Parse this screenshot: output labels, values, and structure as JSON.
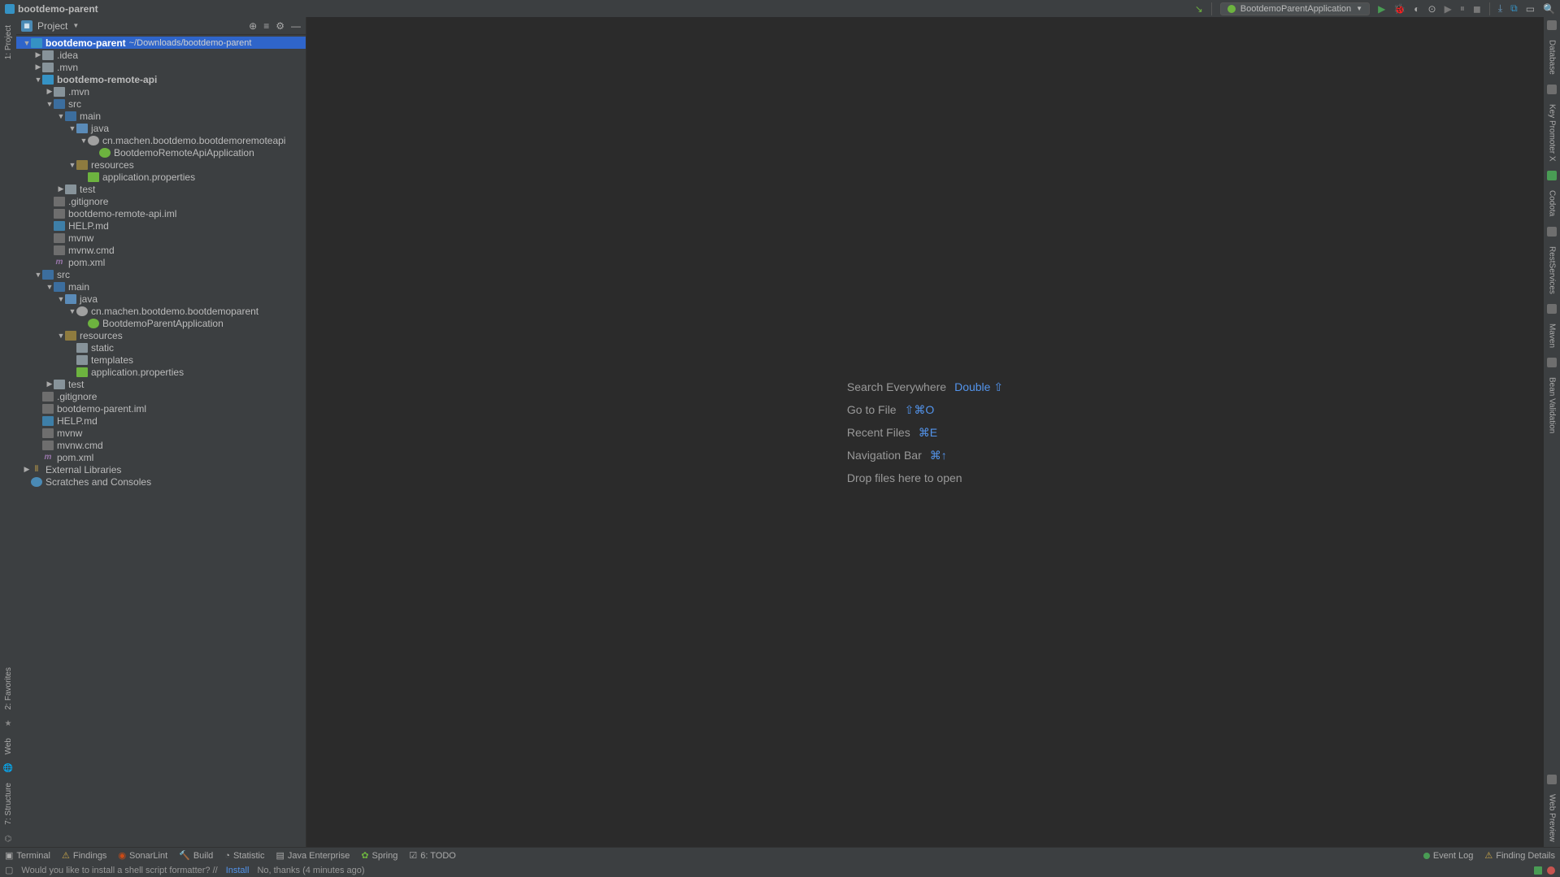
{
  "topbar": {
    "project_name": "bootdemo-parent",
    "run_config": "BootdemoParentApplication"
  },
  "panel": {
    "title": "Project"
  },
  "tree": [
    {
      "d": 0,
      "a": "down",
      "i": "module-icon",
      "t": "bootdemo-parent",
      "path": "~/Downloads/bootdemo-parent",
      "sel": true,
      "name": "project-root",
      "bold": true
    },
    {
      "d": 1,
      "a": "right",
      "i": "folder-icon",
      "t": ".idea",
      "name": "folder-idea"
    },
    {
      "d": 1,
      "a": "right",
      "i": "folder-icon",
      "t": ".mvn",
      "name": "folder-mvn"
    },
    {
      "d": 1,
      "a": "down",
      "i": "module-icon",
      "t": "bootdemo-remote-api",
      "name": "module-remote-api",
      "bold": true
    },
    {
      "d": 2,
      "a": "right",
      "i": "folder-icon",
      "t": ".mvn",
      "name": "folder-mvn-2"
    },
    {
      "d": 2,
      "a": "down",
      "i": "src-folder",
      "t": "src",
      "name": "folder-src"
    },
    {
      "d": 3,
      "a": "down",
      "i": "src-folder",
      "t": "main",
      "name": "folder-main"
    },
    {
      "d": 4,
      "a": "down",
      "i": "java-folder",
      "t": "java",
      "name": "folder-java"
    },
    {
      "d": 5,
      "a": "down",
      "i": "pkg-icon",
      "t": "cn.machen.bootdemo.bootdemoremoteapi",
      "name": "package"
    },
    {
      "d": 6,
      "a": "none",
      "i": "class-icon",
      "t": "BootdemoRemoteApiApplication",
      "name": "class-remote-app"
    },
    {
      "d": 4,
      "a": "down",
      "i": "res-folder",
      "t": "resources",
      "name": "folder-resources"
    },
    {
      "d": 5,
      "a": "none",
      "i": "prop-icon",
      "t": "application.properties",
      "name": "file-app-props"
    },
    {
      "d": 3,
      "a": "right",
      "i": "folder-icon",
      "t": "test",
      "name": "folder-test"
    },
    {
      "d": 2,
      "a": "none",
      "i": "file-icon",
      "t": ".gitignore",
      "name": "file-gitignore"
    },
    {
      "d": 2,
      "a": "none",
      "i": "file-icon",
      "t": "bootdemo-remote-api.iml",
      "name": "file-iml"
    },
    {
      "d": 2,
      "a": "none",
      "i": "md-icon",
      "t": "HELP.md",
      "name": "file-help-md"
    },
    {
      "d": 2,
      "a": "none",
      "i": "file-icon",
      "t": "mvnw",
      "name": "file-mvnw"
    },
    {
      "d": 2,
      "a": "none",
      "i": "file-icon",
      "t": "mvnw.cmd",
      "name": "file-mvnw-cmd"
    },
    {
      "d": 2,
      "a": "none",
      "i": "xml-icon",
      "t": "pom.xml",
      "name": "file-pom",
      "xml": "m"
    },
    {
      "d": 1,
      "a": "down",
      "i": "src-folder",
      "t": "src",
      "name": "folder-src-2"
    },
    {
      "d": 2,
      "a": "down",
      "i": "src-folder",
      "t": "main",
      "name": "folder-main-2"
    },
    {
      "d": 3,
      "a": "down",
      "i": "java-folder",
      "t": "java",
      "name": "folder-java-2"
    },
    {
      "d": 4,
      "a": "down",
      "i": "pkg-icon",
      "t": "cn.machen.bootdemo.bootdemoparent",
      "name": "package-2"
    },
    {
      "d": 5,
      "a": "none",
      "i": "class-icon",
      "t": "BootdemoParentApplication",
      "name": "class-parent-app"
    },
    {
      "d": 3,
      "a": "down",
      "i": "res-folder",
      "t": "resources",
      "name": "folder-resources-2"
    },
    {
      "d": 4,
      "a": "none",
      "i": "folder-icon",
      "t": "static",
      "name": "folder-static"
    },
    {
      "d": 4,
      "a": "none",
      "i": "folder-icon",
      "t": "templates",
      "name": "folder-templates"
    },
    {
      "d": 4,
      "a": "none",
      "i": "prop-icon",
      "t": "application.properties",
      "name": "file-app-props-2"
    },
    {
      "d": 2,
      "a": "right",
      "i": "folder-icon",
      "t": "test",
      "name": "folder-test-2"
    },
    {
      "d": 1,
      "a": "none",
      "i": "file-icon",
      "t": ".gitignore",
      "name": "file-gitignore-2"
    },
    {
      "d": 1,
      "a": "none",
      "i": "file-icon",
      "t": "bootdemo-parent.iml",
      "name": "file-iml-2"
    },
    {
      "d": 1,
      "a": "none",
      "i": "md-icon",
      "t": "HELP.md",
      "name": "file-help-md-2"
    },
    {
      "d": 1,
      "a": "none",
      "i": "file-icon",
      "t": "mvnw",
      "name": "file-mvnw-2"
    },
    {
      "d": 1,
      "a": "none",
      "i": "file-icon",
      "t": "mvnw.cmd",
      "name": "file-mvnw-cmd-2"
    },
    {
      "d": 1,
      "a": "none",
      "i": "xml-icon",
      "t": "pom.xml",
      "name": "file-pom-2",
      "xml": "m"
    },
    {
      "d": 0,
      "a": "right",
      "i": "lib-icon",
      "t": "External Libraries",
      "name": "external-libraries",
      "glyph": "⫴"
    },
    {
      "d": 0,
      "a": "none",
      "i": "scratch-icon",
      "t": "Scratches and Consoles",
      "name": "scratches"
    }
  ],
  "hints": {
    "search_label": "Search Everywhere",
    "search_key": "Double ⇧",
    "goto_label": "Go to File",
    "goto_key": "⇧⌘O",
    "recent_label": "Recent Files",
    "recent_key": "⌘E",
    "nav_label": "Navigation Bar",
    "nav_key": "⌘↑",
    "drop_label": "Drop files here to open"
  },
  "left_gutter": [
    "1: Project",
    "2: Favorites",
    "Web",
    "7: Structure"
  ],
  "right_gutter": [
    "Database",
    "Key Promoter X",
    "Codota",
    "RestServices",
    "Maven",
    "Bean Validation",
    "Web Preview"
  ],
  "bottom_tools": {
    "terminal": "Terminal",
    "findings": "Findings",
    "sonar": "SonarLint",
    "build": "Build",
    "statistic": "Statistic",
    "java_ee": "Java Enterprise",
    "spring": "Spring",
    "todo": "6: TODO",
    "eventlog": "Event Log",
    "finding_details": "Finding Details"
  },
  "status": {
    "msg": "Would you like to install a shell script formatter? //",
    "install": "Install",
    "nothanks": "No, thanks (4 minutes ago)"
  }
}
